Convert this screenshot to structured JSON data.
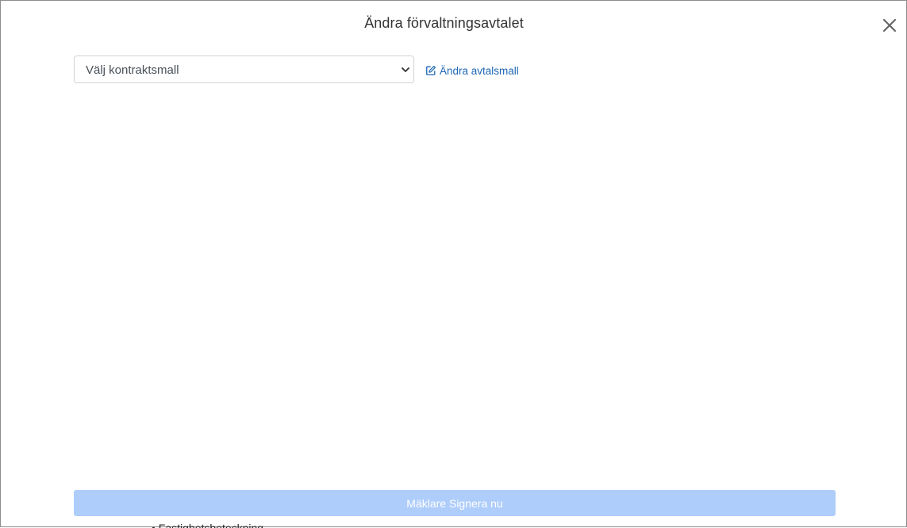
{
  "modal": {
    "title": "Ändra förvaltningsavtalet"
  },
  "contract_select": {
    "selected": "Välj kontraktsmall"
  },
  "edit_template_link": {
    "label": "Ändra avtalsmall",
    "icon": "edit-icon"
  },
  "sign_button": {
    "label": "Mäklare Signera nu"
  },
  "below_fold_text": "• Fastighetsbeteckning",
  "colors": {
    "link": "#1e66b5",
    "button_disabled": "#aecdfb",
    "title": "#333333"
  },
  "icons": {
    "close": "close-icon",
    "chevron": "chevron-down-icon"
  }
}
